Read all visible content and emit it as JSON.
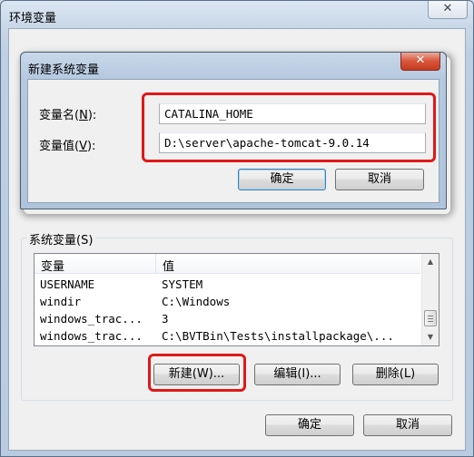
{
  "window": {
    "title": "环境变量",
    "close_glyph": "✕"
  },
  "dialog": {
    "title": "新建系统变量",
    "close_glyph": "✕",
    "name_label": "变量名(N):",
    "name_label_pre": "变量名(",
    "name_label_key": "N",
    "name_label_post": "):",
    "name_value": "CATALINA_HOME",
    "value_label_pre": "变量值(",
    "value_label_key": "V",
    "value_label_post": "):",
    "value_value": "D:\\server\\apache-tomcat-9.0.14",
    "ok_label": "确定",
    "cancel_label": "取消"
  },
  "system_vars": {
    "group_label": "系统变量(S)",
    "columns": [
      "变量",
      "值"
    ],
    "rows": [
      {
        "name": "USERNAME",
        "value": "SYSTEM"
      },
      {
        "name": "windir",
        "value": "C:\\Windows"
      },
      {
        "name": "windows_trac...",
        "value": "3"
      },
      {
        "name": "windows_trac...",
        "value": "C:\\BVTBin\\Tests\\installpackage\\..."
      }
    ],
    "new_label": "新建(W)...",
    "edit_label": "编辑(I)...",
    "delete_label": "删除(L)"
  },
  "footer": {
    "ok_label": "确定",
    "cancel_label": "取消"
  },
  "colors": {
    "highlight": "#e01818",
    "close_red": "#c43b1f"
  }
}
